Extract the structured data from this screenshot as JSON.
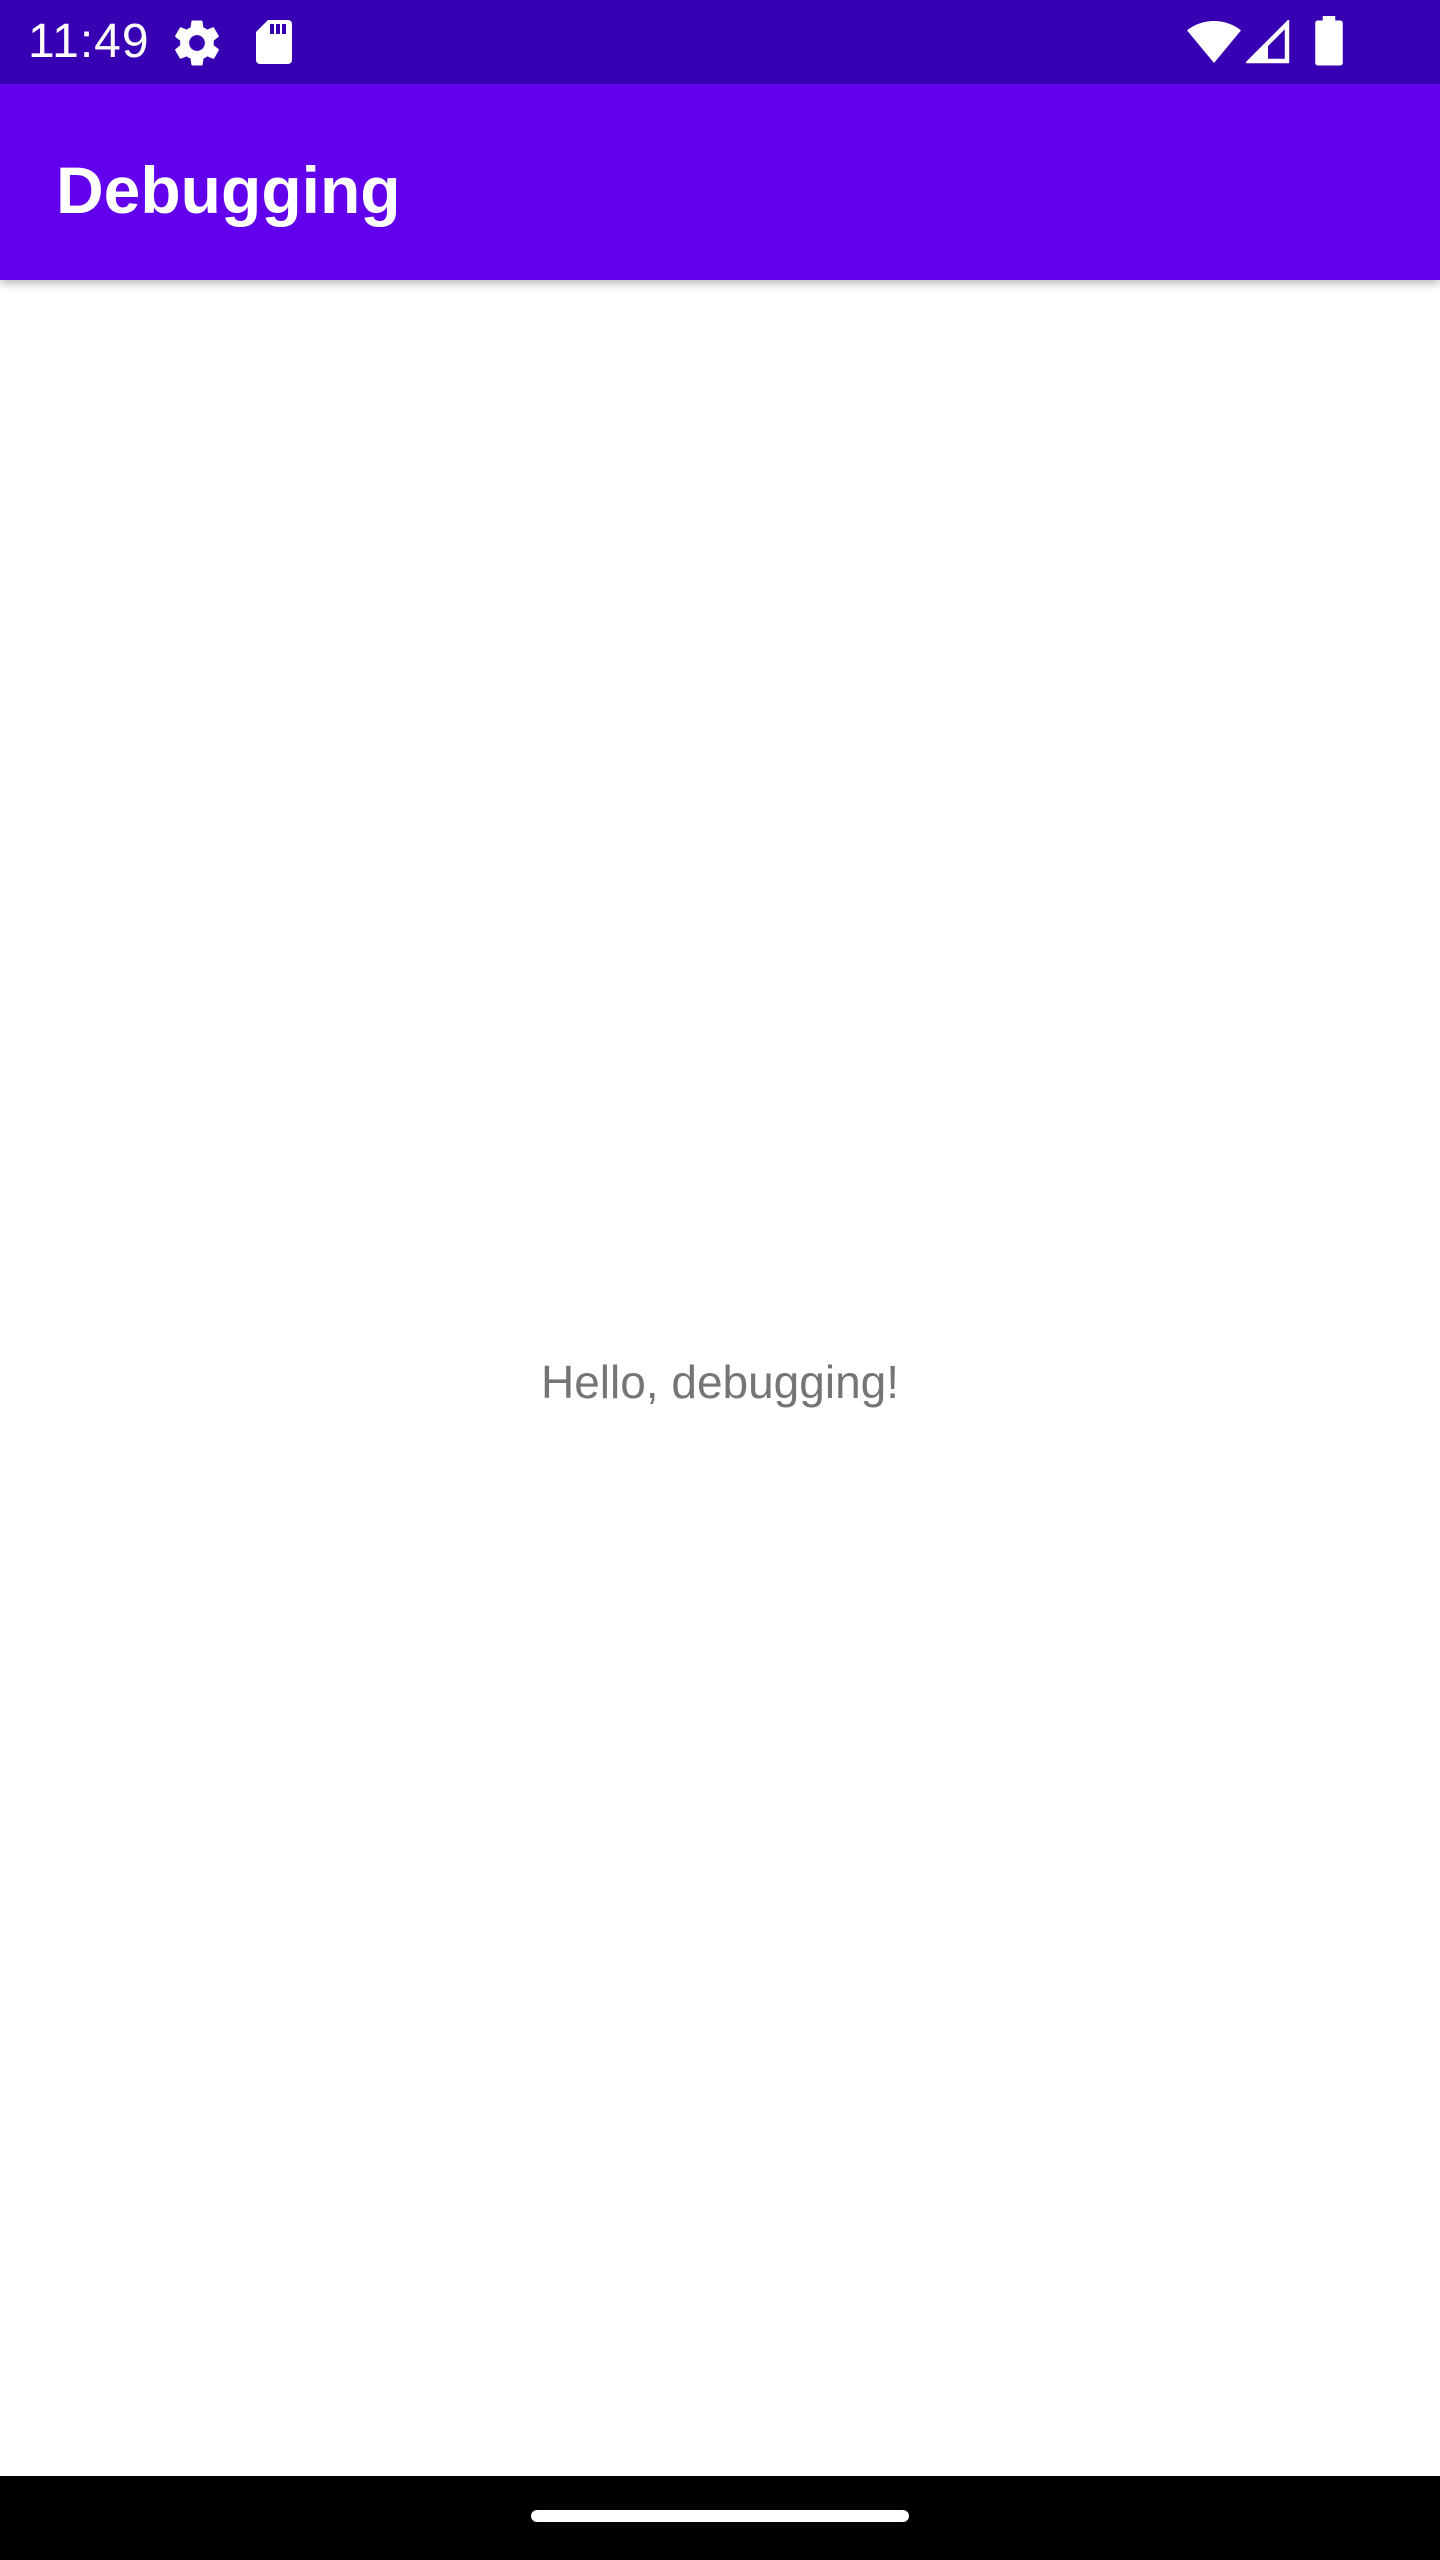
{
  "status_bar": {
    "time": "11:49",
    "icons": [
      "gear-icon",
      "sd-card-icon",
      "wifi-icon",
      "signal-icon",
      "battery-icon"
    ],
    "background": "#3700b3"
  },
  "app_bar": {
    "title": "Debugging",
    "background": "#6200ee"
  },
  "main": {
    "message": "Hello, debugging!"
  },
  "nav_bar": {
    "background": "#000000",
    "handle_icon": "home-handle"
  }
}
